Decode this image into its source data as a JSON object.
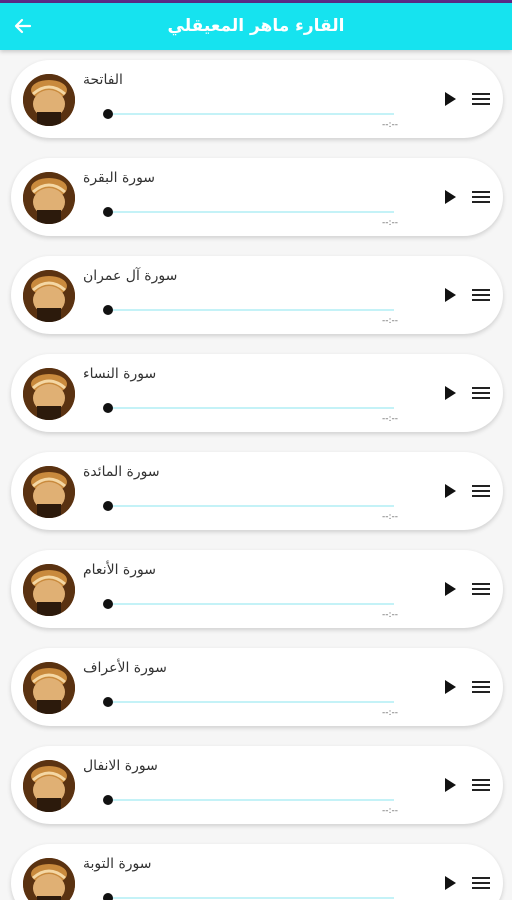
{
  "app_bar": {
    "title": "القارء ماهر المعيقلي",
    "back_icon": "arrow-left-icon",
    "background": "#16e3ef",
    "title_color": "#ffffff"
  },
  "status_bar": {
    "color": "#5b2a86"
  },
  "player": {
    "track_color": "#c4f2f7",
    "play_icon": "play-icon",
    "menu_icon": "menu-icon",
    "avatar_icon": "reciter-avatar"
  },
  "surahs": [
    {
      "name": "الفاتحة",
      "time": "--:--",
      "progress": 0
    },
    {
      "name": "سورة البقرة",
      "time": "--:--",
      "progress": 0
    },
    {
      "name": "سورة آل عمران",
      "time": "--:--",
      "progress": 0
    },
    {
      "name": "سورة النساء",
      "time": "--:--",
      "progress": 0
    },
    {
      "name": "سورة المائدة",
      "time": "--:--",
      "progress": 0
    },
    {
      "name": "سورة الأنعام",
      "time": "--:--",
      "progress": 0
    },
    {
      "name": "سورة الأعراف",
      "time": "--:--",
      "progress": 0
    },
    {
      "name": "سورة الانفال",
      "time": "--:--",
      "progress": 0
    },
    {
      "name": "سورة التوبة",
      "time": "--:--",
      "progress": 0
    }
  ]
}
